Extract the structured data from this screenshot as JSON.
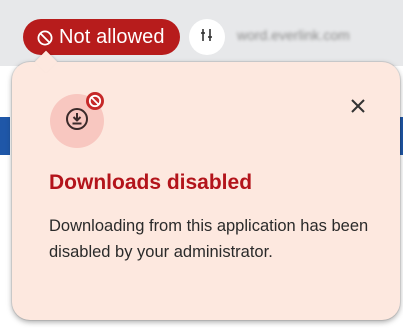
{
  "toolbar": {
    "status_label": "Not allowed",
    "url_text": "word.everlink.com"
  },
  "popup": {
    "title": "Downloads disabled",
    "message": "Downloading from this application has been disabled by your administrator."
  },
  "icons": {
    "status": "ban-icon",
    "site_settings": "tune-icon",
    "download": "download-icon",
    "blocked_badge": "blocked-badge-icon",
    "close": "close-icon"
  },
  "colors": {
    "status_pill": "#b71c1c",
    "popup_bg": "#fde8df",
    "title": "#b3141b",
    "icon_circle": "#f8c7c0"
  }
}
